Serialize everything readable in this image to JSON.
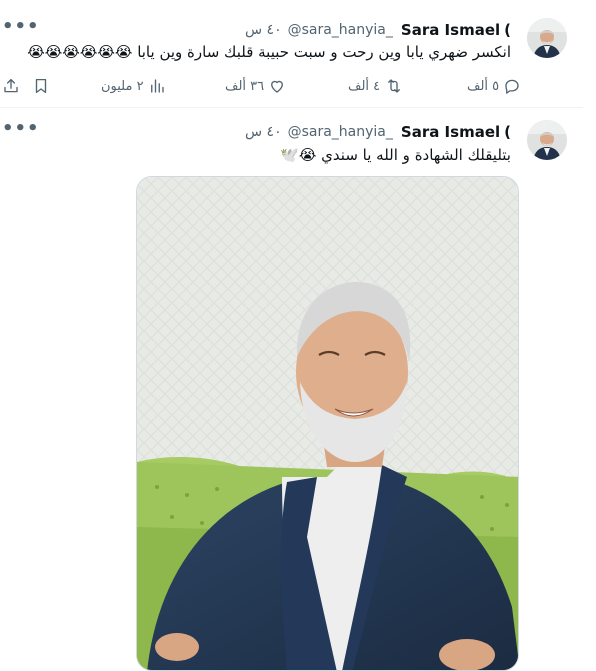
{
  "tweets": [
    {
      "display_name": "Sara Ismael",
      "name_suffix": "(",
      "handle": "@sara_hanyia_",
      "time": "٤٠ س",
      "text": "انكسر ضهري يابا وين رحت و سبت حبيبة قلبك سارة وين يابا",
      "emojis": "😭😭😭😭😭😭",
      "more_label": "•••",
      "actions": {
        "reply_count": "٥ ألف",
        "retweet_count": "٤ ألف",
        "like_count": "٣٦ ألف",
        "views_count": "٢ مليون"
      }
    },
    {
      "display_name": "Sara Ismael",
      "name_suffix": "(",
      "handle": "@sara_hanyia_",
      "time": "٤٠ س",
      "text": "بتليقلك الشهادة و الله يا سندي",
      "emojis": "😭🕊️",
      "more_label": "•••"
    }
  ],
  "colors": {
    "text": "#0f1419",
    "muted": "#536471",
    "divider": "#eff3f4",
    "photo_wall": "#e9ebe8",
    "sofa": "#9cc45a",
    "suit": "#23364f"
  },
  "icons": [
    "reply-icon",
    "retweet-icon",
    "like-icon",
    "views-icon",
    "bookmark-icon",
    "share-icon",
    "more-icon"
  ]
}
